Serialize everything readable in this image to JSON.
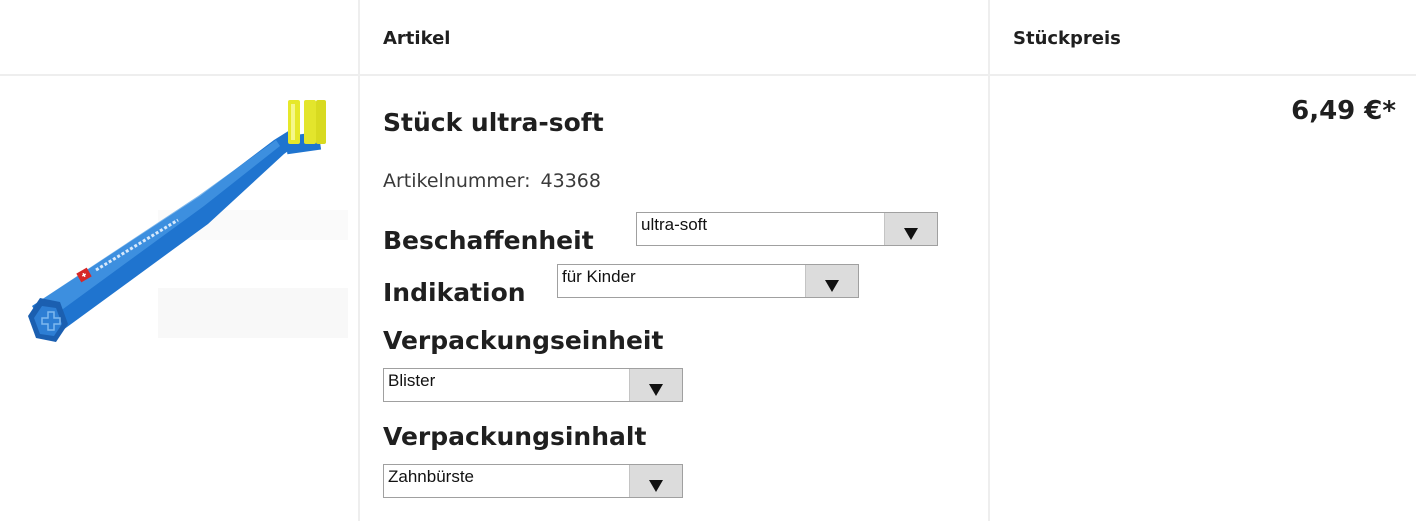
{
  "table": {
    "col_article": "Artikel",
    "col_price": "Stückpreis"
  },
  "product": {
    "image_icon": "toothbrush-image",
    "title": "Stück ultra-soft",
    "sku_label": "Artikelnummer:",
    "sku_value": "43368",
    "price": "6,49 €*"
  },
  "options": [
    {
      "label": "Beschaffenheit",
      "value": "ultra-soft"
    },
    {
      "label": "Indikation",
      "value": "für Kinder"
    },
    {
      "label": "Verpackungseinheit",
      "value": "Blister"
    },
    {
      "label": "Verpackungsinhalt",
      "value": "Zahnbürste"
    }
  ],
  "colors": {
    "brush_handle": "#1a6fc4",
    "bristles": "#e6e82a"
  }
}
